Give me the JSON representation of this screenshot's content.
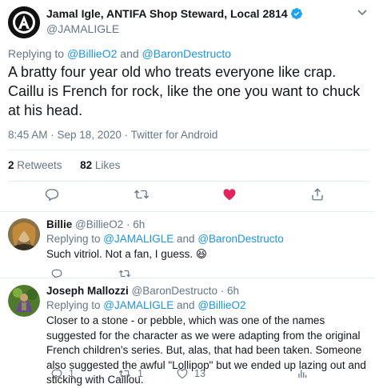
{
  "main_tweet": {
    "author_name": "Jamal Igle, ANTIFA Shop Steward, Local 2814",
    "author_handle": "@JAMALIGLE",
    "replying_prefix": "Replying to ",
    "replying_users": [
      "@BillieO2",
      "@BaronDestructo"
    ],
    "replying_and": " and ",
    "text": "A bratty four year old who treats everyone like crap. Caillu is French for rock, like the one you want to chuck at his head.",
    "timestamp": "8:45 AM · Sep 18, 2020 · Twitter for Android",
    "retweets_count": "2",
    "retweets_label": "Retweets",
    "likes_count": "82",
    "likes_label": "Likes",
    "like_color": "#e0245e"
  },
  "replies": [
    {
      "name": "Billie",
      "handle_time": "@BillieO2 · 6h",
      "replying_prefix": "Replying to ",
      "replying_users": [
        "@JAMALIGLE",
        "@BaronDestructo"
      ],
      "replying_and": " and ",
      "text": "Such vitriol. Not a fan, I guess. 😆",
      "reply_count": "",
      "retweet_count": "",
      "like_count": ""
    },
    {
      "name": "Joseph Mallozzi",
      "handle_time": "@BaronDestructo · 6h",
      "replying_prefix": "Replying to ",
      "replying_users": [
        "@JAMALIGLE",
        "@BillieO2"
      ],
      "replying_and": " and ",
      "text": "Closer to a stone - or pebble, which was one of the names suggested for the character as we were adapting from the original French children's series. But, alas, that had been taken. Someone also suggested the awful \"Lollipop\" but we ended up lazing out and sticking with Caillou.",
      "reply_count": "1",
      "retweet_count": "1",
      "like_count": "13"
    }
  ],
  "colors": {
    "link": "#1b95e0",
    "muted": "#657786",
    "text": "#14171a",
    "verified": "#1da1f2"
  }
}
